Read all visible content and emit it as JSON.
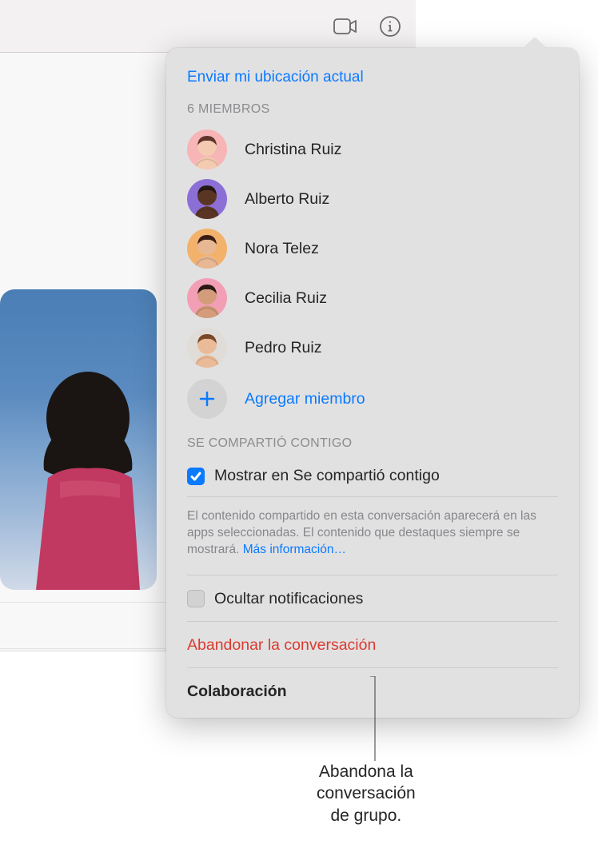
{
  "location_link": "Enviar mi ubicación actual",
  "members_header": "6 MIEMBROS",
  "members": [
    {
      "name": "Christina Ruiz",
      "bg": "#f7b5b7",
      "skin": "#f4cbb1",
      "hair": "#5d332a"
    },
    {
      "name": "Alberto Ruiz",
      "bg": "#8c6fd6",
      "skin": "#5b3523",
      "hair": "#231713"
    },
    {
      "name": "Nora Telez",
      "bg": "#f2b26c",
      "skin": "#e7b893",
      "hair": "#3a1d14"
    },
    {
      "name": "Cecilia Ruiz",
      "bg": "#f29fb6",
      "skin": "#d49c7a",
      "hair": "#2a1914"
    },
    {
      "name": "Pedro Ruiz",
      "bg": "#e0dcd7",
      "skin": "#e9bb99",
      "hair": "#7a4a28"
    }
  ],
  "add_member_label": "Agregar miembro",
  "shared_header": "SE COMPARTIÓ CONTIGO",
  "show_shared_label": "Mostrar en Se compartió contigo",
  "show_shared_checked": true,
  "shared_desc_prefix": "El contenido compartido en esta conversación aparecerá en las apps seleccionadas. El contenido que destaques siempre se mostrará. ",
  "shared_desc_link": "Más información…",
  "hide_notifications_label": "Ocultar notificaciones",
  "hide_notifications_checked": false,
  "leave_label": "Abandonar la conversación",
  "collab_label": "Colaboración",
  "callout": "Abandona la\nconversación\nde grupo."
}
